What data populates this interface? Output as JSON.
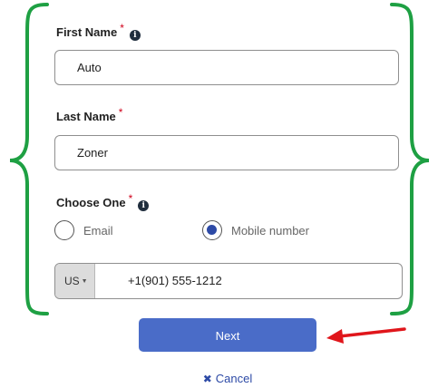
{
  "form": {
    "first_name": {
      "label": "First Name",
      "required_mark": "*",
      "value": "Auto"
    },
    "last_name": {
      "label": "Last Name",
      "required_mark": "*",
      "value": "Zoner"
    },
    "choose_one": {
      "label": "Choose One",
      "required_mark": "*",
      "options": [
        {
          "label": "Email",
          "selected": false
        },
        {
          "label": "Mobile number",
          "selected": true
        }
      ]
    },
    "phone": {
      "country_code": "US",
      "value": "+1(901) 555-1212"
    },
    "next_label": "Next",
    "cancel_label": "Cancel"
  },
  "icons": {
    "info": "info-icon",
    "cancel": "x-icon",
    "caret": "caret-down-icon"
  },
  "colors": {
    "brace": "#1ea043",
    "primary": "#4a6cc8",
    "link": "#2d4aa6",
    "required": "#d0021b",
    "arrow": "#e0161b"
  }
}
